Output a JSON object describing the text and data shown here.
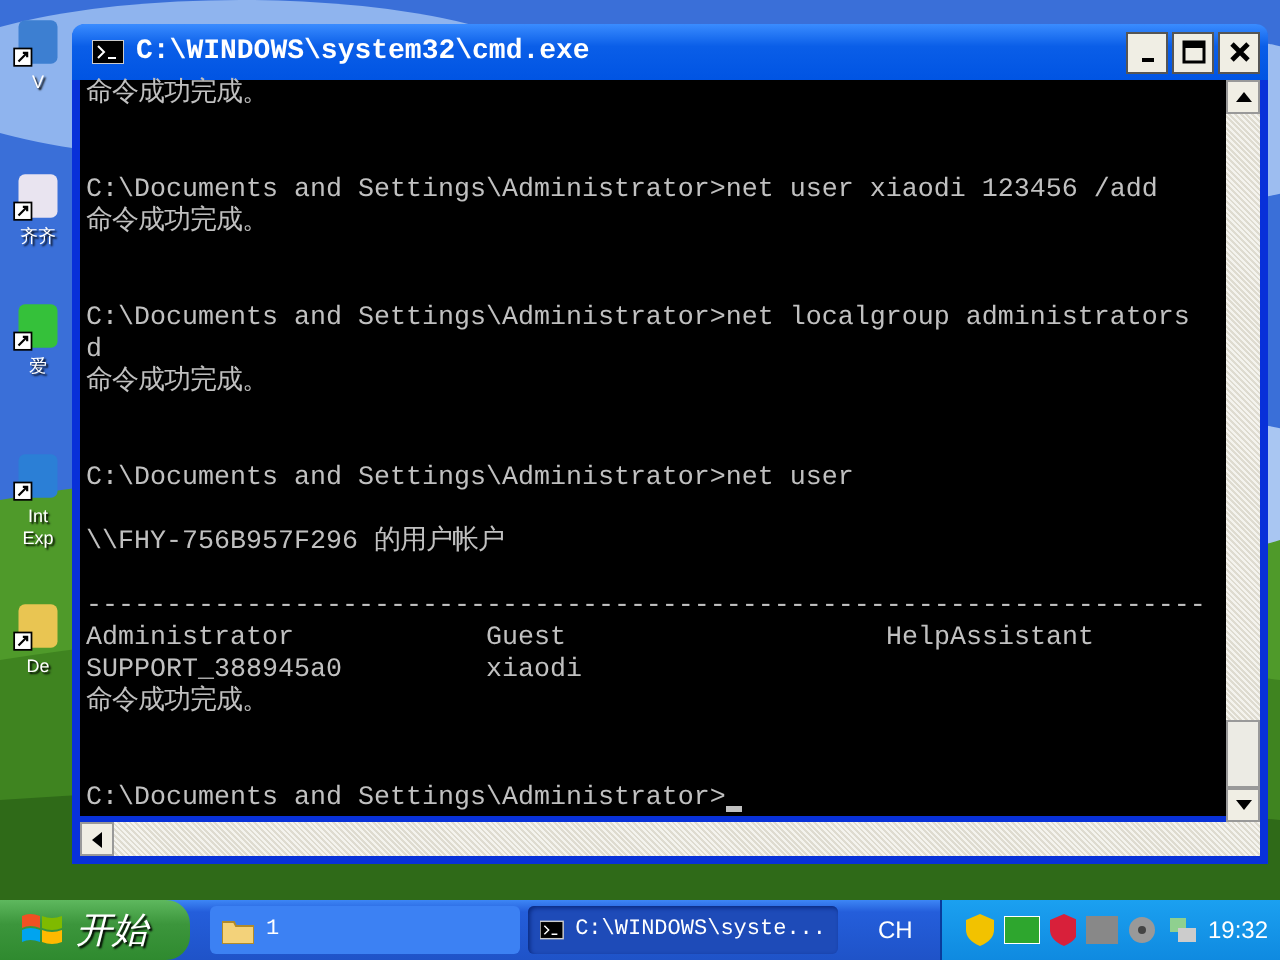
{
  "desktop": {
    "icons": [
      {
        "label": "V"
      },
      {
        "label": "齐齐"
      },
      {
        "label": "爱"
      },
      {
        "label": "Int Exp"
      },
      {
        "label": "De"
      }
    ]
  },
  "window": {
    "title": "C:\\WINDOWS\\system32\\cmd.exe"
  },
  "console": {
    "lines": [
      {
        "kind": "text",
        "text": "命令成功完成。"
      },
      {
        "kind": "blank"
      },
      {
        "kind": "blank"
      },
      {
        "kind": "text",
        "text": "C:\\Documents and Settings\\Administrator>net user xiaodi 123456 /add"
      },
      {
        "kind": "text",
        "text": "命令成功完成。"
      },
      {
        "kind": "blank"
      },
      {
        "kind": "blank"
      },
      {
        "kind": "text",
        "text": "C:\\Documents and Settings\\Administrator>net localgroup administrators"
      },
      {
        "kind": "text",
        "text": "d"
      },
      {
        "kind": "text",
        "text": "命令成功完成。"
      },
      {
        "kind": "blank"
      },
      {
        "kind": "blank"
      },
      {
        "kind": "text",
        "text": "C:\\Documents and Settings\\Administrator>net user"
      },
      {
        "kind": "blank"
      },
      {
        "kind": "text",
        "text": "\\\\FHY-756B957F296 的用户帐户"
      },
      {
        "kind": "blank"
      },
      {
        "kind": "text",
        "text": "----------------------------------------------------------------------"
      },
      {
        "kind": "columns",
        "cells": [
          "Administrator",
          "Guest",
          "HelpAssistant"
        ]
      },
      {
        "kind": "columns",
        "cells": [
          "SUPPORT_388945a0",
          "xiaodi"
        ]
      },
      {
        "kind": "text",
        "text": "命令成功完成。"
      },
      {
        "kind": "blank"
      },
      {
        "kind": "blank"
      },
      {
        "kind": "prompt",
        "text": "C:\\Documents and Settings\\Administrator>"
      }
    ]
  },
  "taskbar": {
    "start": "开始",
    "tasks": [
      {
        "kind": "folder",
        "label": "1",
        "selected": false
      },
      {
        "kind": "console",
        "label": "C:\\WINDOWS\\syste...",
        "selected": true
      }
    ],
    "language": "CH",
    "clock": "19:32"
  }
}
